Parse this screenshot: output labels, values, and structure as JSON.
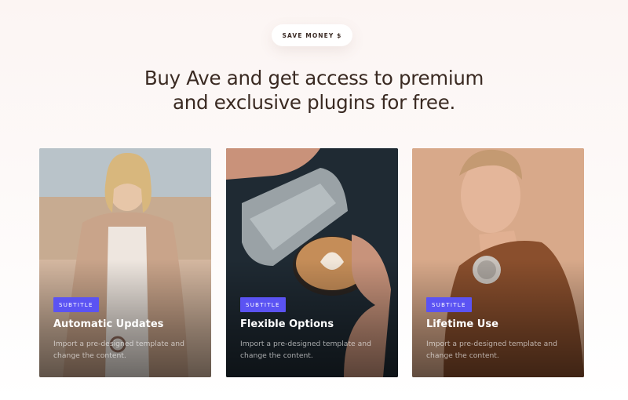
{
  "badge": {
    "label": "SAVE MONEY $"
  },
  "headline": {
    "line1": "Buy Ave and get access to premium",
    "line2": "and exclusive plugins for free."
  },
  "cards": [
    {
      "tag": "SUBTITLE",
      "title": "Automatic Updates",
      "description": "Import a pre-designed template and change the content.",
      "image": "woman-in-trench-coat-photo"
    },
    {
      "tag": "SUBTITLE",
      "title": "Flexible Options",
      "description": "Import a pre-designed template and change the content.",
      "image": "latte-art-pour-photo"
    },
    {
      "tag": "SUBTITLE",
      "title": "Lifetime Use",
      "description": "Import a pre-designed template and change the content.",
      "image": "man-with-headphones-photo"
    }
  ],
  "colors": {
    "accent": "#5b53f3",
    "heading": "#3a2a22",
    "background": "#fcf5f3"
  }
}
